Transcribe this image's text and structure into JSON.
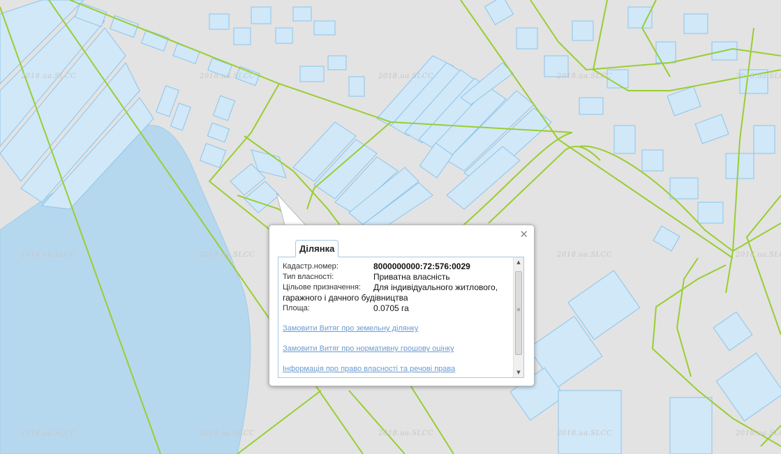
{
  "map": {
    "watermark": "2018.ua.SLCC",
    "colors": {
      "background": "#e3e3e3",
      "water": "#b6d8ee",
      "parcel_fill": "#d1e8f8",
      "parcel_stroke": "#8cc4ea",
      "boundary": "#9acd32"
    }
  },
  "popup": {
    "tab_label": "Ділянка",
    "close_icon": "close-icon",
    "fields": {
      "cadastral_label": "Кадастр.номер:",
      "cadastral_value": "8000000000:72:576:0029",
      "ownership_label": "Тип власності:",
      "ownership_value": "Приватна власність",
      "purpose_label": "Цільове призначення:",
      "purpose_value": "Для індивідуального житлового,",
      "purpose_value_cont": "гаражного і дачного будівництва",
      "area_label": "Площа:",
      "area_value": "0.0705 га"
    },
    "links": {
      "extract_parcel": "Замовити Витяг про земельну ділянку",
      "extract_valuation": "Замовити Витяг про нормативну грошову оцінку",
      "ownership_info": "Інформація про право власності та речові права"
    }
  }
}
